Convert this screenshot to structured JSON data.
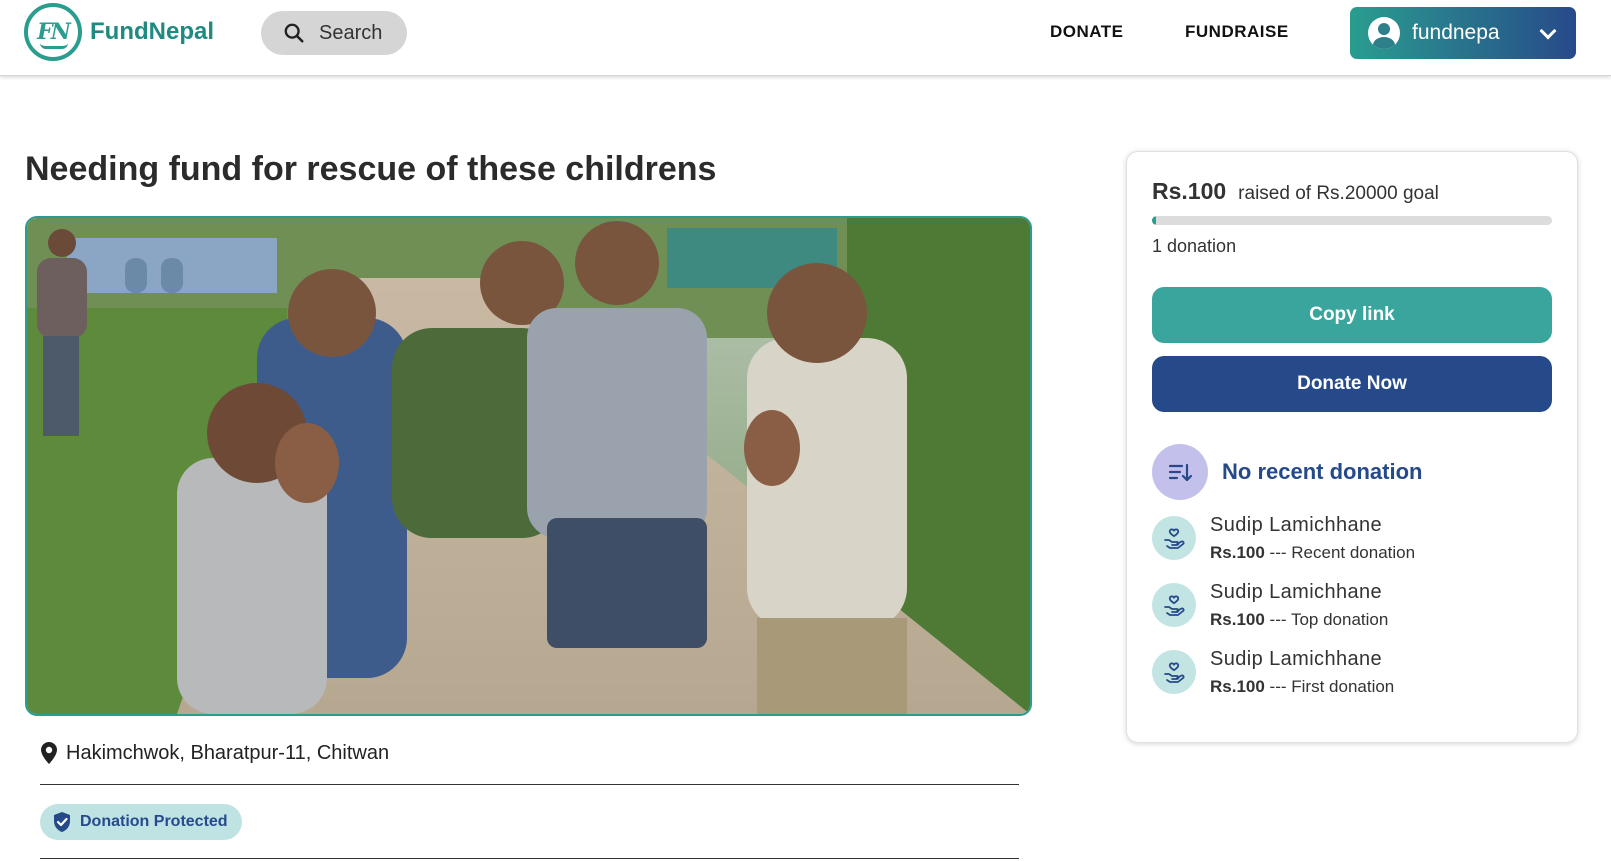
{
  "header": {
    "logo_text": "FundNepal",
    "logo_mark": "FN",
    "search_label": "Search",
    "nav": {
      "donate": "DONATE",
      "fundraise": "FUNDRAISE"
    },
    "user_name": "fundnepa",
    "accent_teal": "#2a9d8f",
    "accent_navy": "#26498a"
  },
  "campaign": {
    "title": "Needing fund for rescue of these childrens",
    "image_alt": "Photo of children",
    "location": "Hakimchwok, Bharatpur-11, Chitwan",
    "badge": "Donation Protected"
  },
  "card": {
    "raised_amount": "Rs.100",
    "raised_goal_text": "raised of Rs.20000 goal",
    "progress_fraction": 0.005,
    "donation_count": "1 donation",
    "copy_link": "Copy link",
    "donate_now": "Donate Now",
    "recent_heading": "No recent donation",
    "donors": [
      {
        "name": "Sudip Lamichhane",
        "amount": "Rs.100",
        "separator": " --- ",
        "kind": "Recent donation"
      },
      {
        "name": "Sudip Lamichhane",
        "amount": "Rs.100",
        "separator": " --- ",
        "kind": "Top donation"
      },
      {
        "name": "Sudip Lamichhane",
        "amount": "Rs.100",
        "separator": " --- ",
        "kind": "First donation"
      }
    ]
  }
}
